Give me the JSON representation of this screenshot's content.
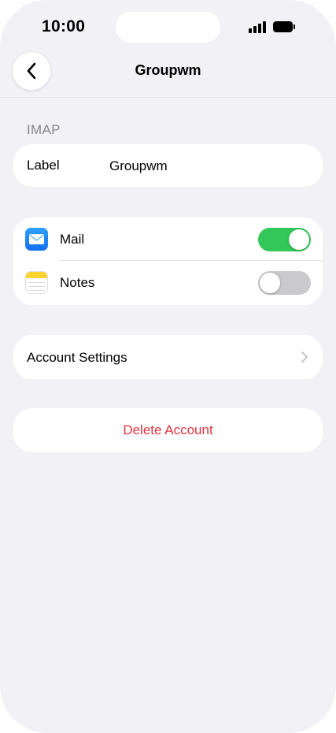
{
  "status_bar": {
    "time": "10:00"
  },
  "nav": {
    "title": "Groupwm"
  },
  "section": {
    "header": "IMAP"
  },
  "label_row": {
    "key": "Label",
    "value": "Groupwm"
  },
  "toggles": [
    {
      "label": "Mail",
      "enabled": true,
      "icon": "mail-icon"
    },
    {
      "label": "Notes",
      "enabled": false,
      "icon": "notes-icon"
    }
  ],
  "account_settings": {
    "label": "Account Settings"
  },
  "delete_account": {
    "label": "Delete Account"
  },
  "colors": {
    "background": "#f2f1f6",
    "toggle_on": "#33c759",
    "toggle_off": "#cacacd",
    "destructive": "#e0333f",
    "secondary_text": "#86858b"
  }
}
